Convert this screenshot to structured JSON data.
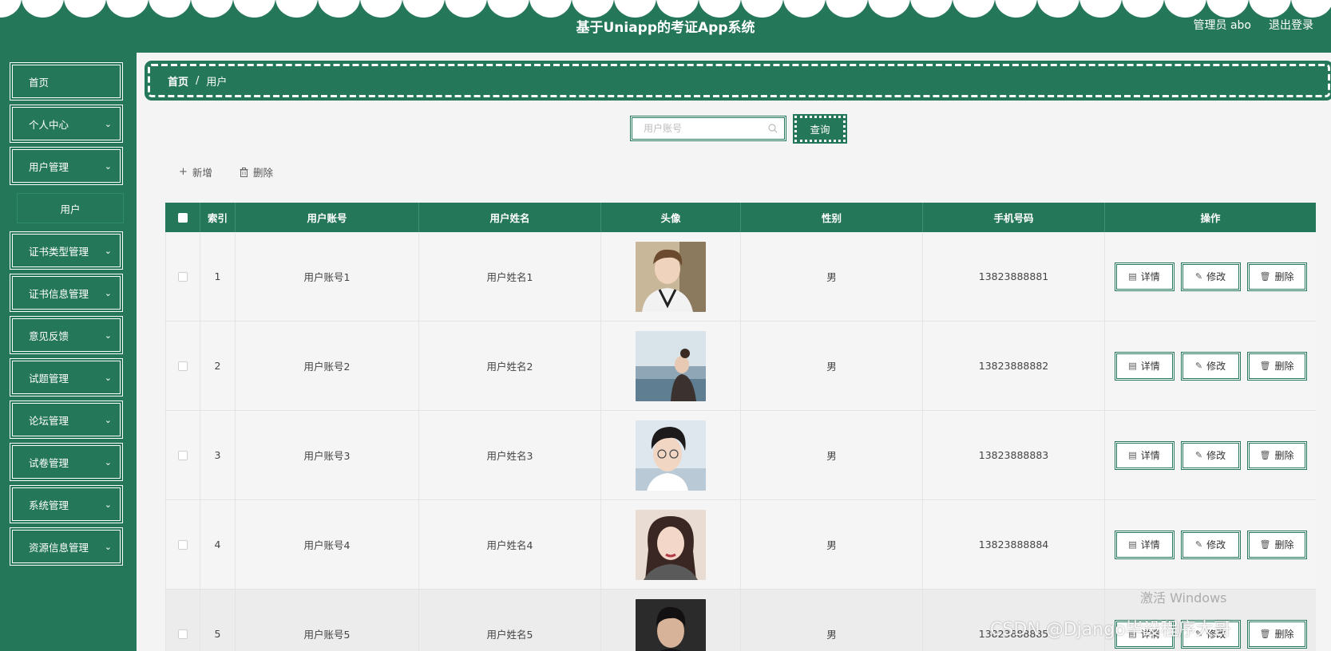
{
  "header": {
    "title": "基于Uniapp的考证App系统",
    "user_label": "管理员 abo",
    "logout_label": "退出登录"
  },
  "sidebar": {
    "items": [
      {
        "label": "首页",
        "has_arrow": false
      },
      {
        "label": "个人中心",
        "has_arrow": true
      },
      {
        "label": "用户管理",
        "has_arrow": true
      },
      {
        "label": "证书类型管理",
        "has_arrow": true
      },
      {
        "label": "证书信息管理",
        "has_arrow": true
      },
      {
        "label": "意见反馈",
        "has_arrow": true
      },
      {
        "label": "试题管理",
        "has_arrow": true
      },
      {
        "label": "论坛管理",
        "has_arrow": true
      },
      {
        "label": "试卷管理",
        "has_arrow": true
      },
      {
        "label": "系统管理",
        "has_arrow": true
      },
      {
        "label": "资源信息管理",
        "has_arrow": true
      }
    ],
    "submenu": {
      "label": "用户"
    }
  },
  "breadcrumb": {
    "home": "首页",
    "separator": "/",
    "current": "用户"
  },
  "search": {
    "placeholder": "用户账号",
    "button_label": "查询"
  },
  "toolbar": {
    "add_label": "新增",
    "delete_label": "删除"
  },
  "table": {
    "headers": [
      "索引",
      "用户账号",
      "用户姓名",
      "头像",
      "性别",
      "手机号码",
      "操作"
    ],
    "actions": {
      "detail": "详情",
      "edit": "修改",
      "delete": "删除"
    },
    "rows": [
      {
        "index": "1",
        "account": "用户账号1",
        "name": "用户姓名1",
        "gender": "男",
        "phone": "13823888881"
      },
      {
        "index": "2",
        "account": "用户账号2",
        "name": "用户姓名2",
        "gender": "男",
        "phone": "13823888882"
      },
      {
        "index": "3",
        "account": "用户账号3",
        "name": "用户姓名3",
        "gender": "男",
        "phone": "13823888883"
      },
      {
        "index": "4",
        "account": "用户账号4",
        "name": "用户姓名4",
        "gender": "男",
        "phone": "13823888884"
      },
      {
        "index": "5",
        "account": "用户账号5",
        "name": "用户姓名5",
        "gender": "男",
        "phone": "13823888885"
      }
    ]
  },
  "watermarks": {
    "windows": "激活 Windows",
    "csdn": "CSDN @Django毕设程序大哥"
  },
  "colors": {
    "primary": "#25775a",
    "background": "#f4f4f4"
  },
  "icons": {
    "add": "plus-icon",
    "delete": "trash-icon",
    "search": "search-icon",
    "detail": "document-icon",
    "edit": "pencil-icon",
    "chevron": "chevron-down-icon"
  }
}
